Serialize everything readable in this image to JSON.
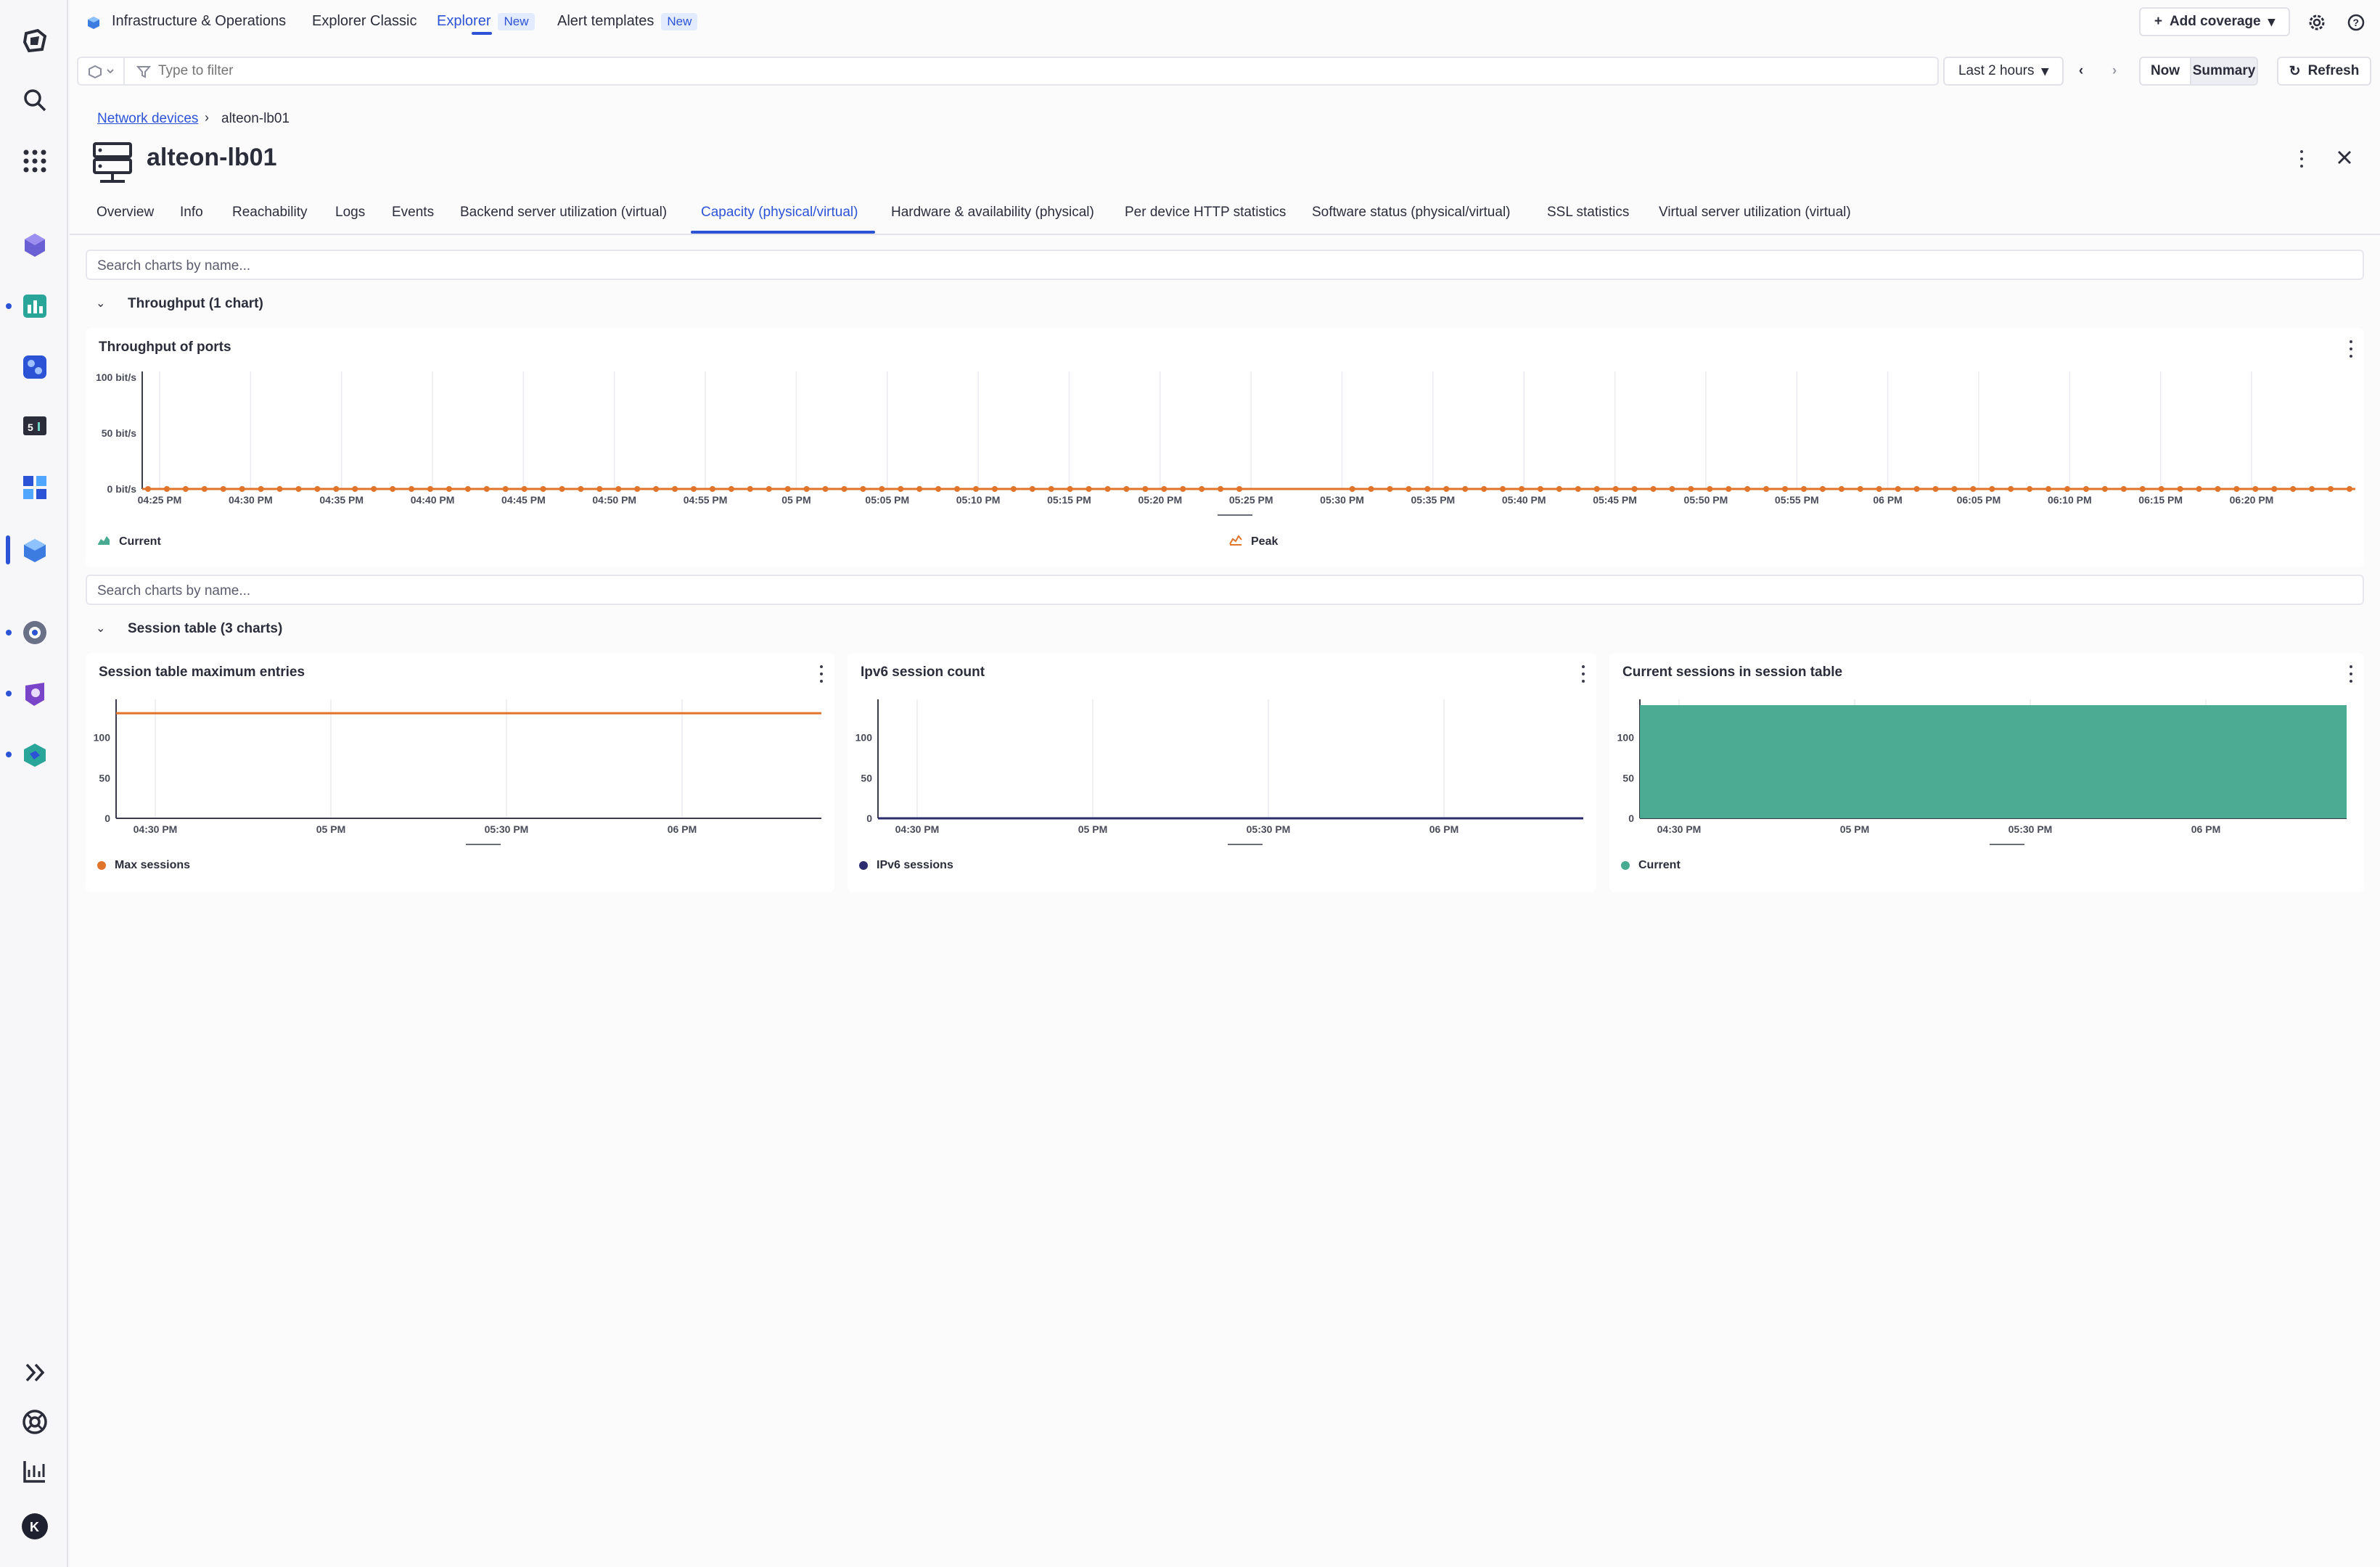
{
  "topbar": {
    "app_title": "Infrastructure & Operations",
    "tabs": [
      {
        "label": "Explorer Classic"
      },
      {
        "label": "Explorer",
        "badge": "New"
      },
      {
        "label": "Alert templates",
        "badge": "New"
      }
    ],
    "add_coverage": "Add coverage"
  },
  "filterbar": {
    "placeholder": "Type to filter",
    "timeframe": "Last 2 hours",
    "now": "Now",
    "summary": "Summary",
    "refresh": "Refresh"
  },
  "breadcrumb": {
    "parent": "Network devices",
    "current": "alteon-lb01"
  },
  "page_title": "alteon-lb01",
  "tabs": [
    "Overview",
    "Info",
    "Reachability",
    "Logs",
    "Events",
    "Backend server utilization (virtual)",
    "Capacity (physical/virtual)",
    "Hardware & availability (physical)",
    "Per device HTTP statistics",
    "Software status (physical/virtual)",
    "SSL statistics",
    "Virtual server utilization (virtual)"
  ],
  "active_tab": "Capacity (physical/virtual)",
  "search_placeholder": "Search charts by name...",
  "groups": {
    "throughput": "Throughput (1 chart)",
    "session": "Session table (3 charts)"
  },
  "colors": {
    "accent": "#2c53d6",
    "orange": "#e0742a",
    "navy": "#2b2d6e",
    "teal": "#48aa91"
  },
  "chart_data": [
    {
      "type": "line",
      "title": "Throughput of ports",
      "y_ticks": [
        "100 bit/s",
        "50 bit/s",
        "0 bit/s"
      ],
      "ylim": [
        0,
        100
      ],
      "categories": [
        "04:25 PM",
        "04:30 PM",
        "04:35 PM",
        "04:40 PM",
        "04:45 PM",
        "04:50 PM",
        "04:55 PM",
        "05 PM",
        "05:05 PM",
        "05:10 PM",
        "05:15 PM",
        "05:20 PM",
        "05:25 PM",
        "05:30 PM",
        "05:35 PM",
        "05:40 PM",
        "05:45 PM",
        "05:50 PM",
        "05:55 PM",
        "06 PM",
        "06:05 PM",
        "06:10 PM",
        "06:15 PM",
        "06:20 PM"
      ],
      "series": [
        {
          "name": "Current",
          "values": [
            0,
            0,
            0,
            0,
            0,
            0,
            0,
            0,
            0,
            0,
            0,
            0,
            0,
            0,
            0,
            0,
            0,
            0,
            0,
            0,
            0,
            0,
            0,
            0
          ]
        },
        {
          "name": "Peak",
          "values": [
            0,
            0,
            0,
            0,
            0,
            0,
            0,
            0,
            0,
            0,
            0,
            0,
            0,
            0,
            0,
            0,
            0,
            0,
            0,
            0,
            0,
            0,
            0,
            0
          ]
        }
      ]
    },
    {
      "type": "line",
      "title": "Session table maximum entries",
      "y_ticks": [
        "100",
        "50",
        "0"
      ],
      "ylim": [
        0,
        140
      ],
      "categories": [
        "04:30 PM",
        "05 PM",
        "05:30 PM",
        "06 PM"
      ],
      "series": [
        {
          "name": "Max sessions",
          "values": [
            130,
            130,
            130,
            130
          ]
        }
      ]
    },
    {
      "type": "line",
      "title": "Ipv6 session count",
      "y_ticks": [
        "100",
        "50",
        "0"
      ],
      "ylim": [
        0,
        140
      ],
      "categories": [
        "04:30 PM",
        "05 PM",
        "05:30 PM",
        "06 PM"
      ],
      "series": [
        {
          "name": "IPv6 sessions",
          "values": [
            0,
            0,
            0,
            0
          ]
        }
      ]
    },
    {
      "type": "area",
      "title": "Current sessions in session table",
      "y_ticks": [
        "100",
        "50",
        "0"
      ],
      "ylim": [
        0,
        140
      ],
      "categories": [
        "04:30 PM",
        "05 PM",
        "05:30 PM",
        "06 PM"
      ],
      "series": [
        {
          "name": "Current",
          "values": [
            140,
            140,
            140,
            140
          ]
        }
      ]
    }
  ]
}
